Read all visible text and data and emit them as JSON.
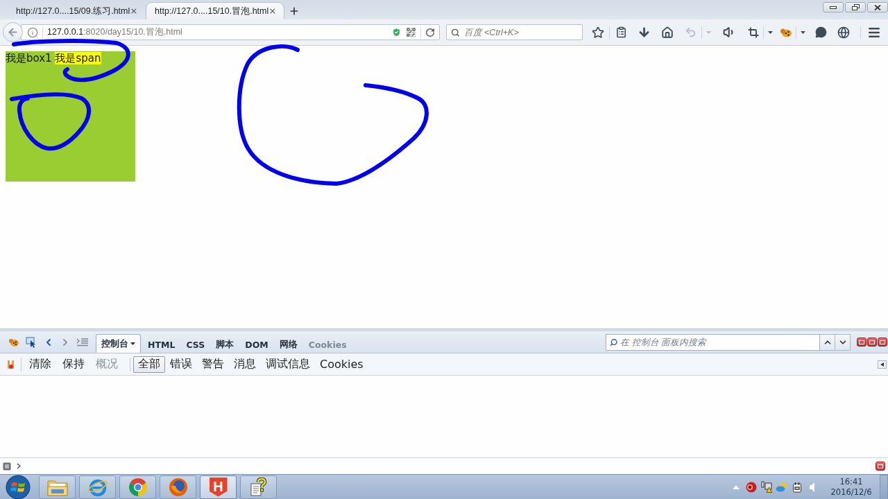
{
  "browser_tabs": [
    {
      "title": "http://127.0....15/09.练习.html",
      "selected": false
    },
    {
      "title": "http://127.0....15/10.冒泡.html",
      "selected": true
    }
  ],
  "address_bar": {
    "url_host": "127.0.0.1",
    "url_path": ":8020/day15/10.冒泡.html"
  },
  "search_bar": {
    "placeholder": "百度 <Ctrl+K>"
  },
  "page": {
    "box_text": "我是box1",
    "span_text": "我是span"
  },
  "firebug": {
    "tabs": [
      {
        "label": "控制台",
        "selected": true,
        "disabled": false
      },
      {
        "label": "HTML",
        "selected": false,
        "disabled": false
      },
      {
        "label": "CSS",
        "selected": false,
        "disabled": false
      },
      {
        "label": "脚本",
        "selected": false,
        "disabled": false
      },
      {
        "label": "DOM",
        "selected": false,
        "disabled": false
      },
      {
        "label": "网络",
        "selected": false,
        "disabled": false
      },
      {
        "label": "Cookies",
        "selected": false,
        "disabled": true
      }
    ],
    "search": {
      "placeholder": "在 控制台 面板内搜索"
    },
    "console_buttons": [
      {
        "label": "清除",
        "disabled": false
      },
      {
        "label": "保持",
        "disabled": false
      },
      {
        "label": "概况",
        "disabled": true
      }
    ],
    "filters": [
      {
        "label": "全部",
        "selected": true
      },
      {
        "label": "错误",
        "selected": false
      },
      {
        "label": "警告",
        "selected": false
      },
      {
        "label": "消息",
        "selected": false
      },
      {
        "label": "调试信息",
        "selected": false
      },
      {
        "label": "Cookies",
        "selected": false
      }
    ]
  },
  "taskbar": {
    "app_logo_letter": "H",
    "time": "16:41",
    "date": "2016/12/6"
  }
}
